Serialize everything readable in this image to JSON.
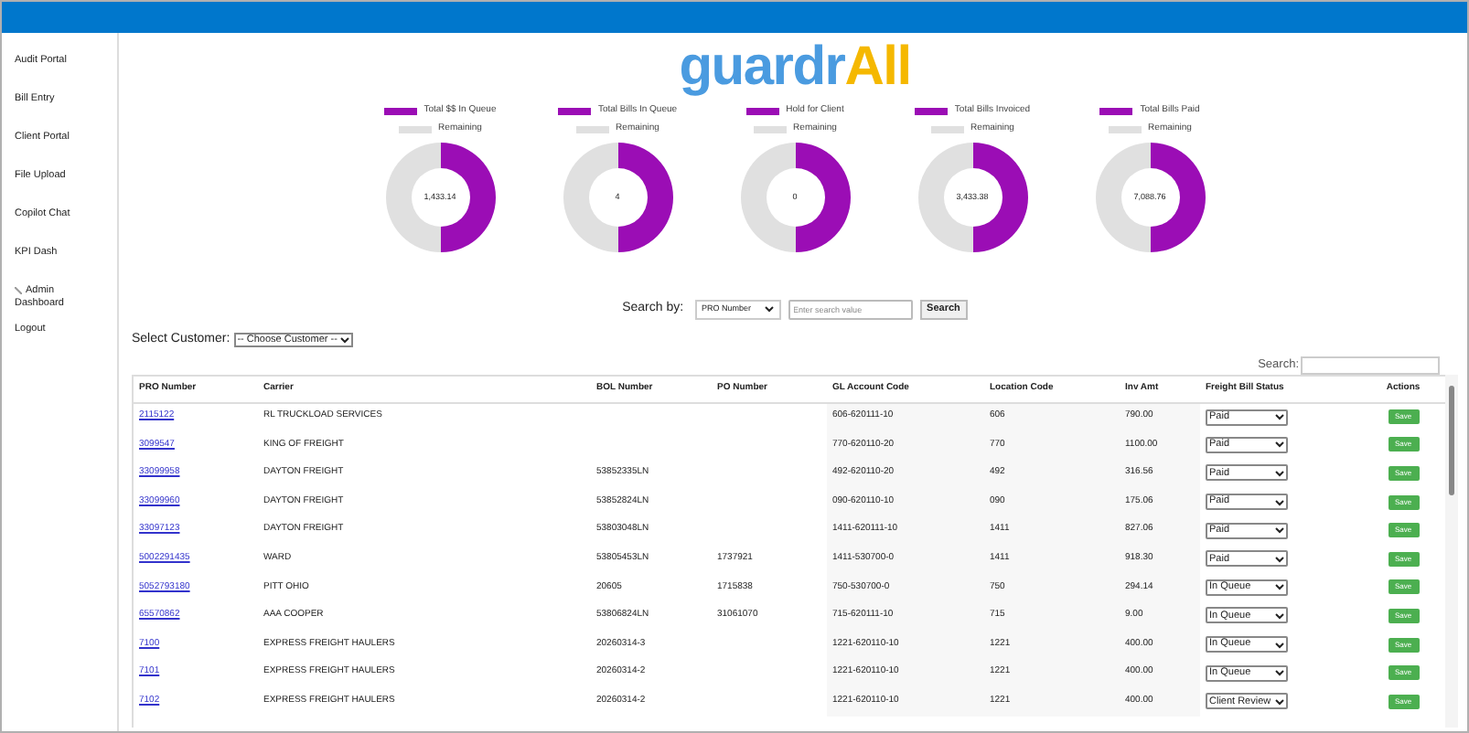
{
  "sidebar": {
    "items": [
      {
        "label": "Audit Portal"
      },
      {
        "label": "Bill Entry"
      },
      {
        "label": "Client Portal"
      },
      {
        "label": "File Upload"
      },
      {
        "label": "Copilot Chat"
      },
      {
        "label": "KPI Dash"
      },
      {
        "label": "Admin Dashboard",
        "kind": "icon"
      },
      {
        "label": "Logout"
      }
    ]
  },
  "logo": {
    "first": "guardr",
    "second": "All"
  },
  "kpis": [
    {
      "legend": "Total $$ In Queue",
      "remaining": "Remaining",
      "value": "1,433.14"
    },
    {
      "legend": "Total Bills In Queue",
      "remaining": "Remaining",
      "value": "4"
    },
    {
      "legend": "Hold for Client",
      "remaining": "Remaining",
      "value": "0"
    },
    {
      "legend": "Total Bills Invoiced",
      "remaining": "Remaining",
      "value": "3,433.38"
    },
    {
      "legend": "Total Bills Paid",
      "remaining": "Remaining",
      "value": "7,088.76"
    }
  ],
  "search_by": {
    "label": "Search by:",
    "field": "PRO Number",
    "placeholder": "Enter search value",
    "button": "Search"
  },
  "customer": {
    "label": "Select Customer:",
    "value": "-- Choose Customer --"
  },
  "table_search": {
    "label": "Search:"
  },
  "table": {
    "columns": [
      "PRO Number",
      "Carrier",
      "BOL Number",
      "PO Number",
      "GL Account Code",
      "Location Code",
      "Inv Amt",
      "Freight Bill Status",
      "Actions"
    ],
    "rows": [
      {
        "pro": "2115122",
        "carrier": "RL TRUCKLOAD SERVICES",
        "gl": "606-620111-10",
        "location": "606",
        "amount": "790.00",
        "status": "Paid",
        "action": "Save"
      },
      {
        "pro": "3099547",
        "carrier": "KING OF FREIGHT",
        "gl": "770-620110-20",
        "location": "770",
        "amount": "1100.00",
        "status": "Paid",
        "action": "Save"
      },
      {
        "pro": "33099958",
        "carrier": "DAYTON FREIGHT",
        "bol": "53852335LN",
        "gl": "492-620110-20",
        "location": "492",
        "amount": "316.56",
        "status": "Paid",
        "action": "Save"
      },
      {
        "pro": "33099960",
        "carrier": "DAYTON FREIGHT",
        "bol": "53852824LN",
        "gl": "090-620110-10",
        "location": "090",
        "amount": "175.06",
        "status": "Paid",
        "action": "Save"
      },
      {
        "pro": "33097123",
        "carrier": "DAYTON FREIGHT",
        "bol": "53803048LN",
        "gl": "1411-620111-10",
        "location": "1411",
        "amount": "827.06",
        "status": "Paid",
        "action": "Save"
      },
      {
        "pro": "5002291435",
        "carrier": "WARD",
        "bol": "53805453LN",
        "po": "1737921",
        "gl": "1411-530700-0",
        "location": "1411",
        "amount": "918.30",
        "status": "Paid",
        "action": "Save"
      },
      {
        "pro": "5052793180",
        "carrier": "PITT OHIO",
        "bol": "20605",
        "po": "1715838",
        "gl": "750-530700-0",
        "location": "750",
        "amount": "294.14",
        "status": "In Queue",
        "action": "Save"
      },
      {
        "pro": "65570862",
        "carrier": "AAA COOPER",
        "bol": "53806824LN",
        "po": "31061070",
        "gl": "715-620111-10",
        "location": "715",
        "amount": "9.00",
        "status": "In Queue",
        "action": "Save"
      },
      {
        "pro": "7100",
        "carrier": "EXPRESS FREIGHT HAULERS",
        "bol": "20260314-3",
        "gl": "1221-620110-10",
        "location": "1221",
        "amount": "400.00",
        "status": "In Queue",
        "action": "Save"
      },
      {
        "pro": "7101",
        "carrier": "EXPRESS FREIGHT HAULERS",
        "bol": "20260314-2",
        "gl": "1221-620110-10",
        "location": "1221",
        "amount": "400.00",
        "status": "In Queue",
        "action": "Save"
      },
      {
        "pro": "7102",
        "carrier": "EXPRESS FREIGHT HAULERS",
        "bol": "20260314-2",
        "gl": "1221-620110-10",
        "location": "1221",
        "amount": "400.00",
        "status": "Client Review",
        "action": "Save"
      }
    ]
  }
}
